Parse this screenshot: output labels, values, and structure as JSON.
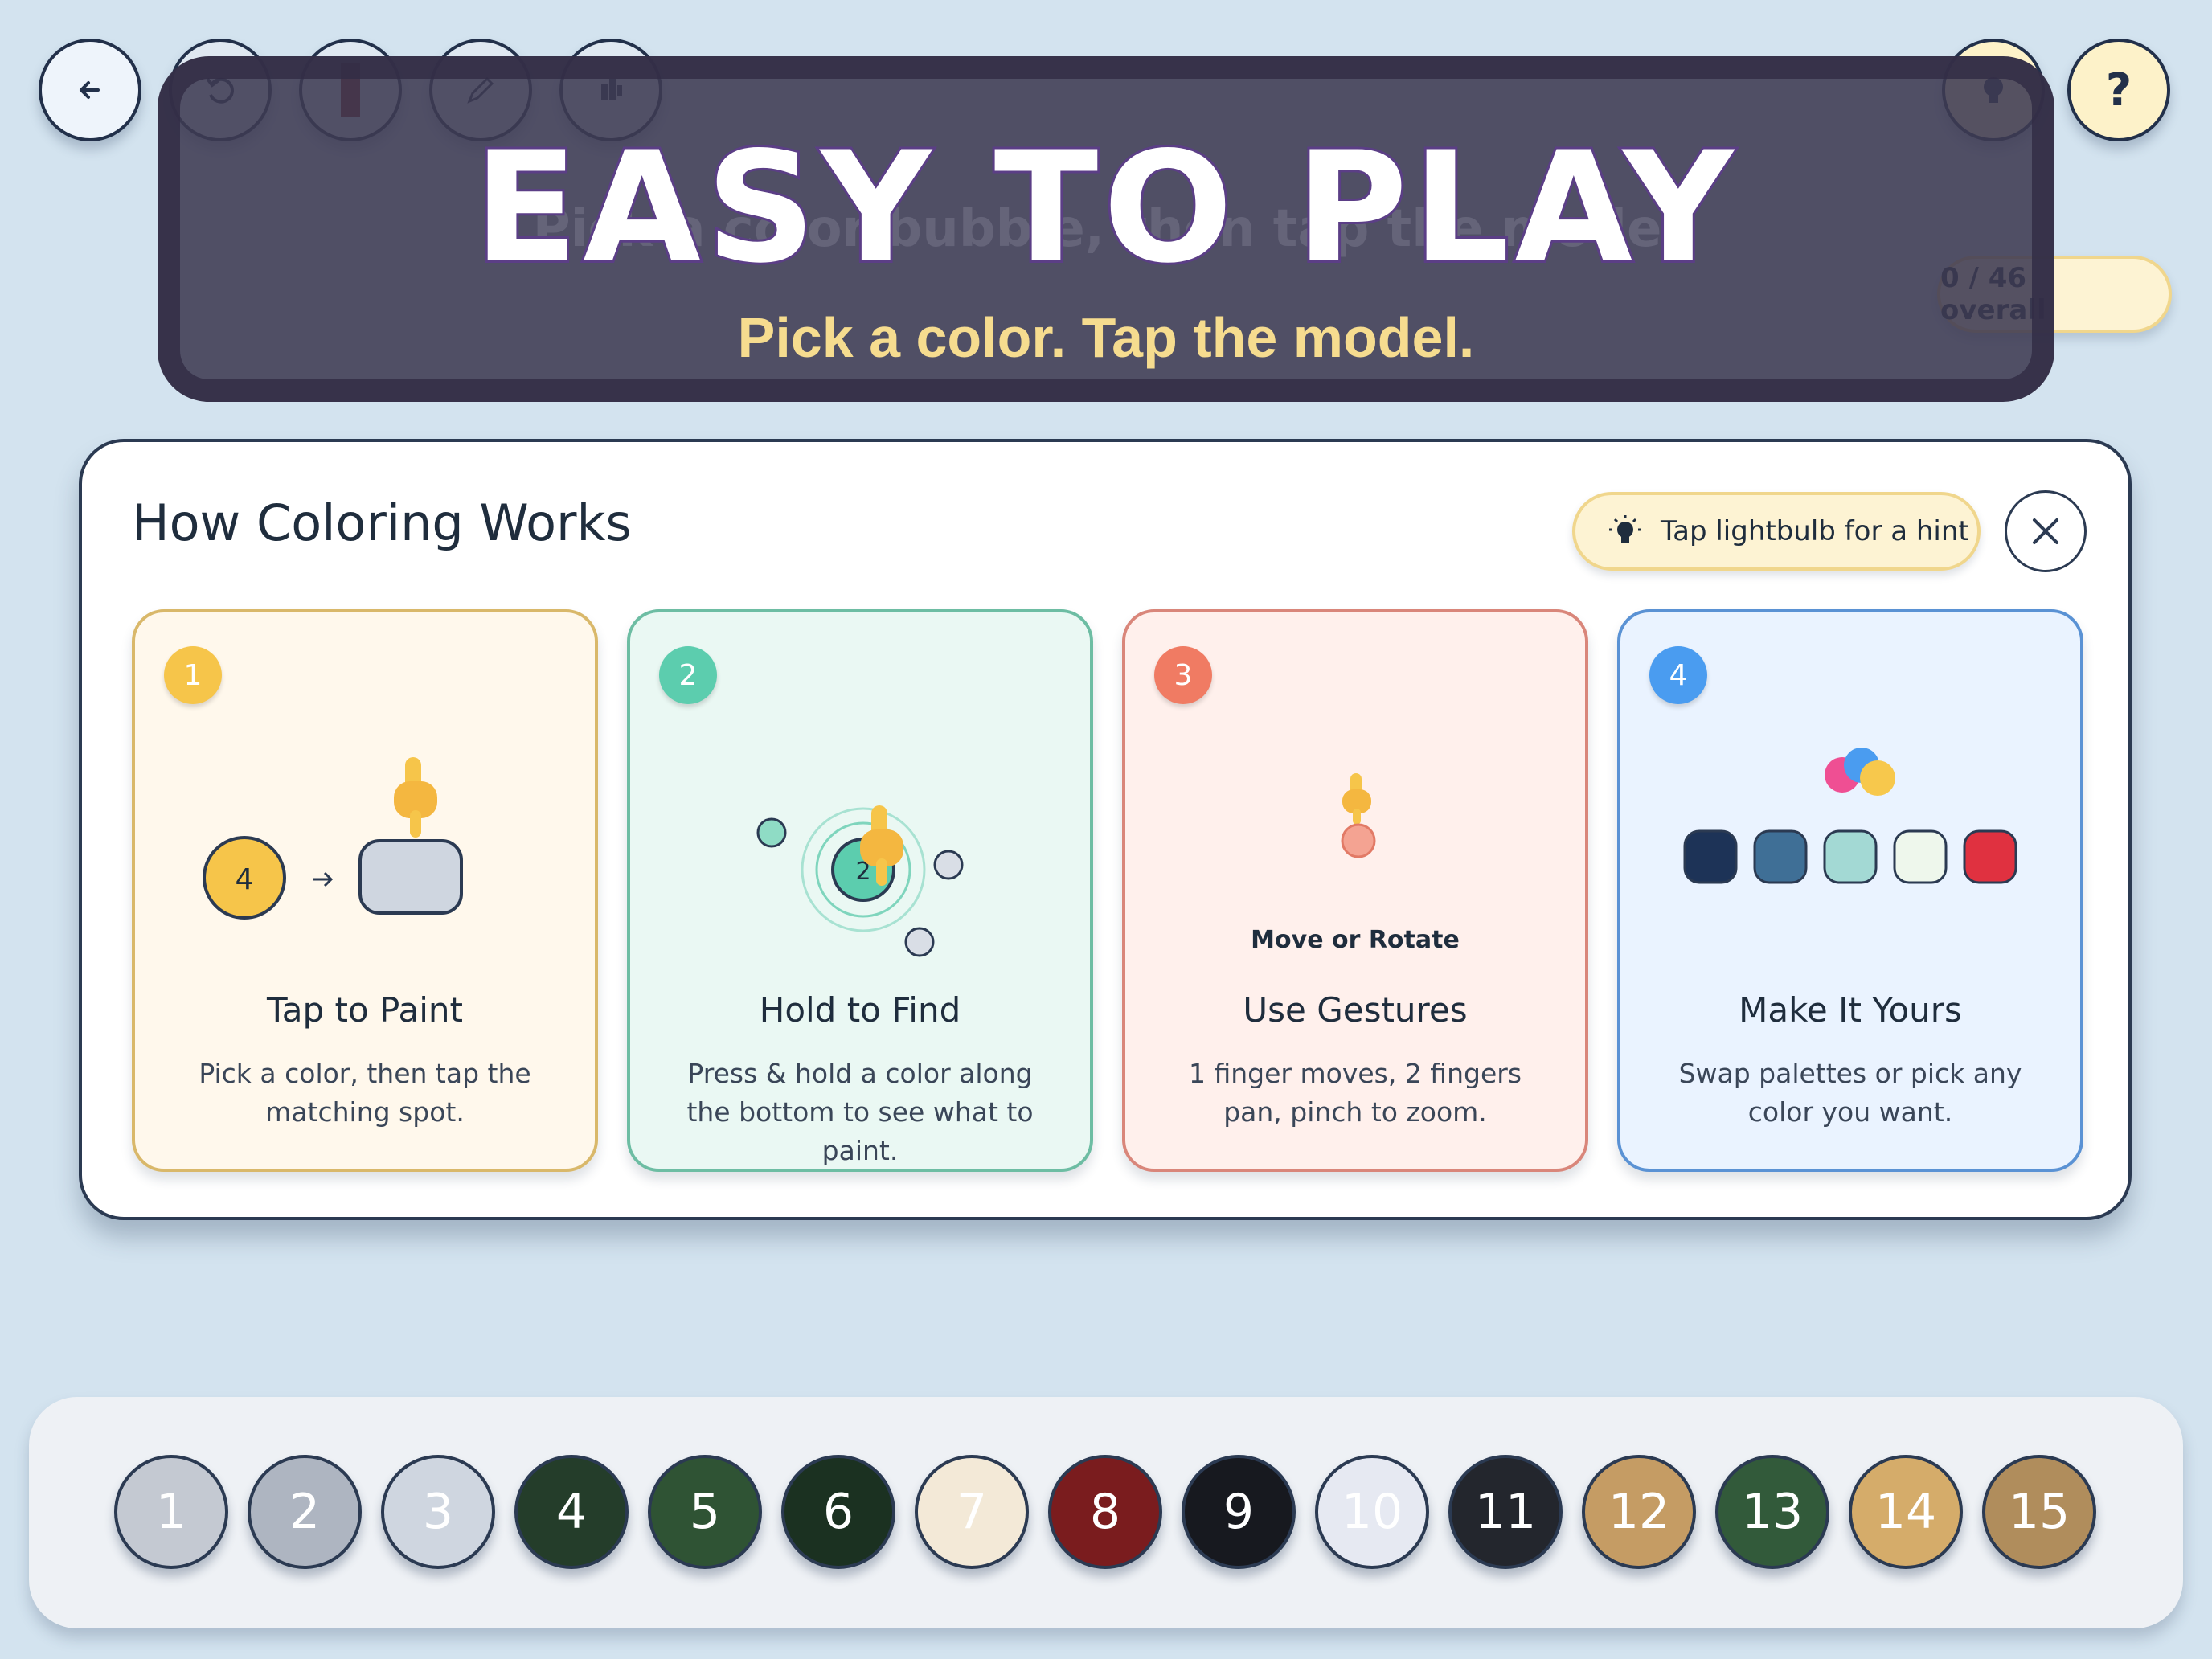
{
  "toolbar": {
    "back_icon": "arrow-left-icon",
    "undo_icon": "undo-icon",
    "color_icon": "color-swatch-icon",
    "pencil_icon": "pencil-icon",
    "hand_icon": "hand-icon",
    "hint_icon": "lightbulb-icon",
    "help_label": "?"
  },
  "banner": {
    "title": "EASY TO PLAY",
    "subtitle": "Pick a color. Tap the model.",
    "ghost_text": "Pick a color bubble, then tap the model"
  },
  "progress": {
    "overall_label": "0 / 46 overall"
  },
  "modal": {
    "title": "How Coloring Works",
    "hint_label": "Tap lightbulb for a hint",
    "close_icon": "close-icon",
    "cards": [
      {
        "number": "1",
        "title": "Tap to Paint",
        "description": "Pick a color, then tap the matching spot.",
        "bubble_number": "4",
        "color": "#f6c54a",
        "bg": "#fff8ec",
        "border": "#d9b86a"
      },
      {
        "number": "2",
        "title": "Hold to Find",
        "description": "Press & hold a color along the bottom to see what to paint.",
        "bubble_number": "2",
        "color": "#5ccdae",
        "bg": "#eaf8f3",
        "border": "#6dbda3"
      },
      {
        "number": "3",
        "title": "Use Gestures",
        "description": "1 finger moves, 2 fingers pan, pinch to zoom.",
        "gesture_label": "Move or Rotate",
        "color": "#f07b63",
        "bg": "#fff0ec",
        "border": "#d9867a"
      },
      {
        "number": "4",
        "title": "Make It Yours",
        "description": "Swap palettes or pick any color you want.",
        "color": "#4a9cf0",
        "bg": "#eaf3ff",
        "border": "#5a92d4",
        "palette_colors": [
          "#1d3357",
          "#3f6f96",
          "#a3d9d4",
          "#eef7ec",
          "#e03140"
        ]
      }
    ]
  },
  "palette": [
    {
      "label": "1",
      "color": "#c4c9d2",
      "text": "#ffffff"
    },
    {
      "label": "2",
      "color": "#aeb5c1",
      "text": "#ffffff"
    },
    {
      "label": "3",
      "color": "#cfd6e0",
      "text": "#ffffff"
    },
    {
      "label": "4",
      "color": "#243d2a",
      "text": "#ffffff"
    },
    {
      "label": "5",
      "color": "#2f5334",
      "text": "#ffffff"
    },
    {
      "label": "6",
      "color": "#1b3121",
      "text": "#ffffff"
    },
    {
      "label": "7",
      "color": "#f3e9d7",
      "text": "#ffffff"
    },
    {
      "label": "8",
      "color": "#7a1c1e",
      "text": "#ffffff"
    },
    {
      "label": "9",
      "color": "#17191f",
      "text": "#ffffff"
    },
    {
      "label": "10",
      "color": "#e6e9f2",
      "text": "#ffffff"
    },
    {
      "label": "11",
      "color": "#23262d",
      "text": "#ffffff"
    },
    {
      "label": "12",
      "color": "#c59c64",
      "text": "#ffffff"
    },
    {
      "label": "13",
      "color": "#325a3a",
      "text": "#ffffff"
    },
    {
      "label": "14",
      "color": "#d5ac6a",
      "text": "#ffffff"
    },
    {
      "label": "15",
      "color": "#b08d5c",
      "text": "#ffffff"
    }
  ]
}
